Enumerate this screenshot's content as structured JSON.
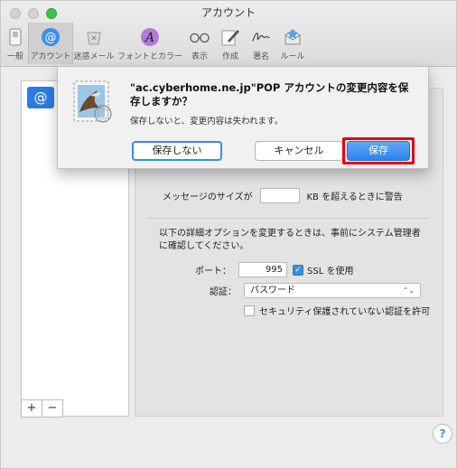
{
  "window": {
    "title": "アカウント"
  },
  "toolbar": {
    "items": [
      {
        "label": "一般",
        "icon": "switch-icon"
      },
      {
        "label": "アカウント",
        "icon": "at-icon"
      },
      {
        "label": "迷惑メール",
        "icon": "trash-icon"
      },
      {
        "label": "フォントとカラー",
        "icon": "font-icon"
      },
      {
        "label": "表示",
        "icon": "glasses-icon"
      },
      {
        "label": "作成",
        "icon": "pencil-icon"
      },
      {
        "label": "署名",
        "icon": "signature-icon"
      },
      {
        "label": "ルール",
        "icon": "rules-icon"
      }
    ],
    "active_index": 1
  },
  "sidebar": {
    "account_icon": "@",
    "add_label": "+",
    "remove_label": "−"
  },
  "dialog": {
    "title": "\"ac.cyberhome.ne.jp\"POP アカウントの変更内容を保存しますか？",
    "message": "保存しないと、変更内容は失われます。",
    "dont_save_label": "保存しない",
    "cancel_label": "キャンセル",
    "save_label": "保存",
    "highlight_color": "#e60012"
  },
  "settings": {
    "message_size_label": "メッセージのサイズが",
    "message_size_value": "",
    "message_size_suffix": "KB を超えるときに警告",
    "advanced_note": "以下の詳細オプションを変更するときは、事前にシステム管理者に確認してください。",
    "port_label": "ポート：",
    "port_value": "995",
    "ssl_label": "SSL を使用",
    "ssl_checked": true,
    "auth_label": "認証：",
    "auth_value": "パスワード",
    "insecure_auth_label": "セキュリティ保護されていない認証を許可",
    "insecure_auth_checked": false
  },
  "help_label": "?"
}
